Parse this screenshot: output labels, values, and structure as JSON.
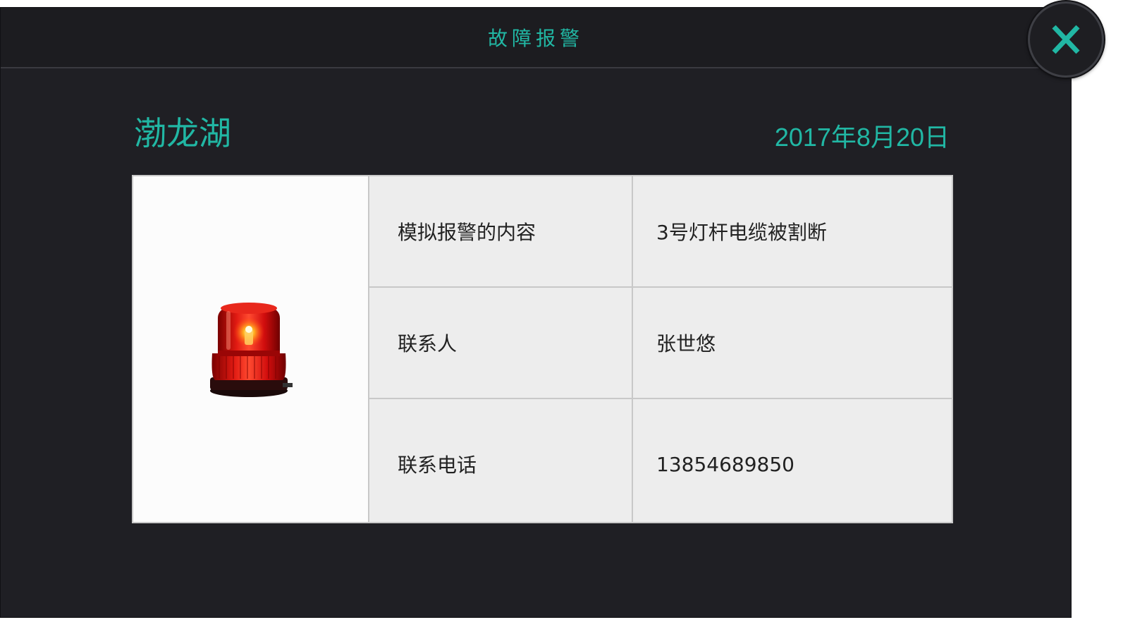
{
  "dialog": {
    "title": "故障报警",
    "close_label": "X"
  },
  "header": {
    "location": "渤龙湖",
    "date": "2017年8月20日"
  },
  "alarm_image": {
    "icon": "red-warning-beacon-icon"
  },
  "details": [
    {
      "label": "模拟报警的内容",
      "value": "3号灯杆电缆被割断"
    },
    {
      "label": "联系人",
      "value": "张世悠"
    },
    {
      "label": "联系电话",
      "value": "13854689850"
    }
  ],
  "colors": {
    "accent": "#21b7a4",
    "background": "#1f1f24",
    "table_bg": "#ededed",
    "beacon_red": "#d40f0f"
  }
}
